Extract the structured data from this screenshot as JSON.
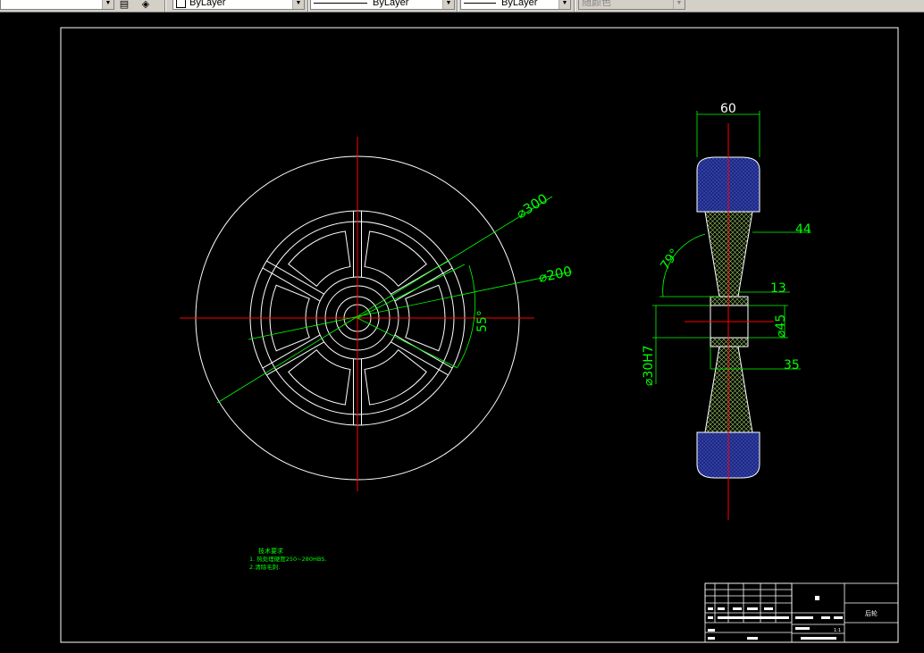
{
  "toolbar": {
    "color_combo": "ByLayer",
    "linetype_combo": "ByLayer",
    "lineweight_combo": "ByLayer",
    "plotstyle_combo": "随颜色"
  },
  "drawing": {
    "colors": {
      "background": "#000000",
      "outline": "#ffffff",
      "centerline": "#ff0000",
      "dimension": "#00ff00",
      "tire_hatch": "#1a237e"
    },
    "dims": {
      "d300": "⌀300",
      "d200": "⌀200",
      "angle55": "55°",
      "width60": "60",
      "w44": "44",
      "angle79": "79°",
      "w13": "13",
      "d45": "⌀45",
      "bore": "⌀30H7",
      "w35": "35"
    },
    "notes": {
      "title": "技术要求",
      "line1": "1. 热处理硬度250~280HBS.",
      "line2": "2.清除毛刺."
    },
    "title_block": {
      "part_name": "后轮",
      "scale": "1:1"
    }
  }
}
